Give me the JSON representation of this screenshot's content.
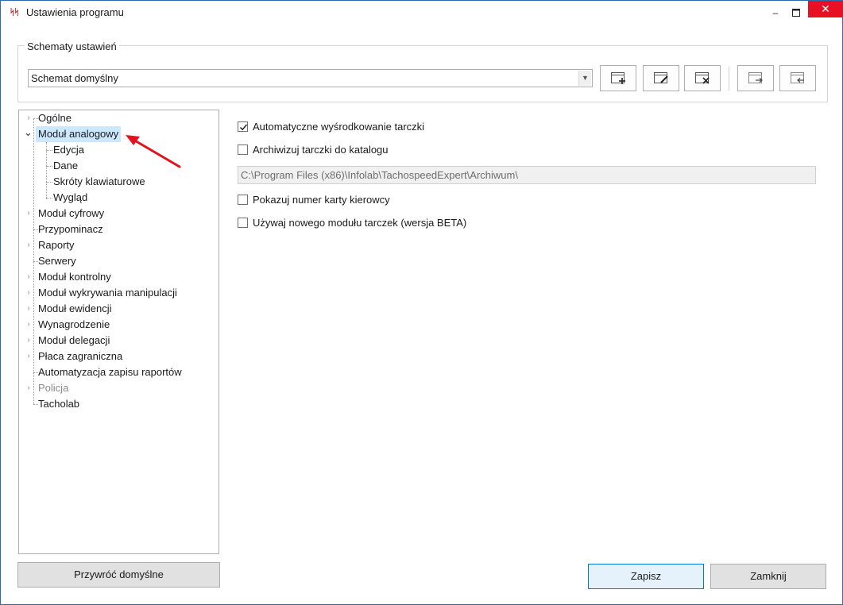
{
  "window": {
    "title": "Ustawienia programu",
    "app_icon_text": "ᛋᛋ",
    "min_glyph": "–",
    "max_glyph": "■",
    "close_glyph": "✕"
  },
  "schemes": {
    "legend": "Schematy ustawień",
    "selected": "Schemat domyślny",
    "dropdown_glyph": "▼"
  },
  "toolbar": {
    "buttons": [
      "new-scheme-icon",
      "edit-scheme-icon",
      "delete-scheme-icon",
      "export-scheme-icon",
      "import-scheme-icon"
    ]
  },
  "tree": {
    "items": [
      {
        "label": "Ogólne",
        "expander": "›"
      },
      {
        "label": "Moduł analogowy",
        "expander": "⌄"
      },
      {
        "label": "Edycja"
      },
      {
        "label": "Dane"
      },
      {
        "label": "Skróty klawiaturowe"
      },
      {
        "label": "Wygląd"
      },
      {
        "label": "Moduł cyfrowy",
        "expander": "›"
      },
      {
        "label": "Przypominacz"
      },
      {
        "label": "Raporty",
        "expander": "›"
      },
      {
        "label": "Serwery"
      },
      {
        "label": "Moduł kontrolny",
        "expander": "›"
      },
      {
        "label": "Moduł wykrywania manipulacji",
        "expander": "›"
      },
      {
        "label": "Moduł ewidencji",
        "expander": "›"
      },
      {
        "label": "Wynagrodzenie",
        "expander": "›"
      },
      {
        "label": "Moduł delegacji",
        "expander": "›"
      },
      {
        "label": "Płaca zagraniczna",
        "expander": "›"
      },
      {
        "label": "Automatyzacja zapisu raportów"
      },
      {
        "label": "Policja",
        "expander": "›"
      },
      {
        "label": "Tacholab"
      }
    ]
  },
  "options": {
    "auto_center": {
      "label": "Automatyczne wyśrodkowanie tarczki",
      "checked": true
    },
    "archive": {
      "label": "Archiwizuj tarczki do katalogu",
      "checked": false
    },
    "archive_path": "C:\\Program Files (x86)\\Infolab\\TachospeedExpert\\Archiwum\\",
    "show_driver_card": {
      "label": "Pokazuj numer karty kierowcy",
      "checked": false
    },
    "new_module": {
      "label": "Używaj nowego modułu tarczek (wersja BETA)",
      "checked": false
    }
  },
  "buttons": {
    "restore": "Przywróć domyślne",
    "save": "Zapisz",
    "close": "Zamknij"
  },
  "colors": {
    "accent": "#0078d7",
    "selection": "#cce8ff",
    "close_button": "#e81123",
    "annotation_arrow": "#e0121b"
  }
}
